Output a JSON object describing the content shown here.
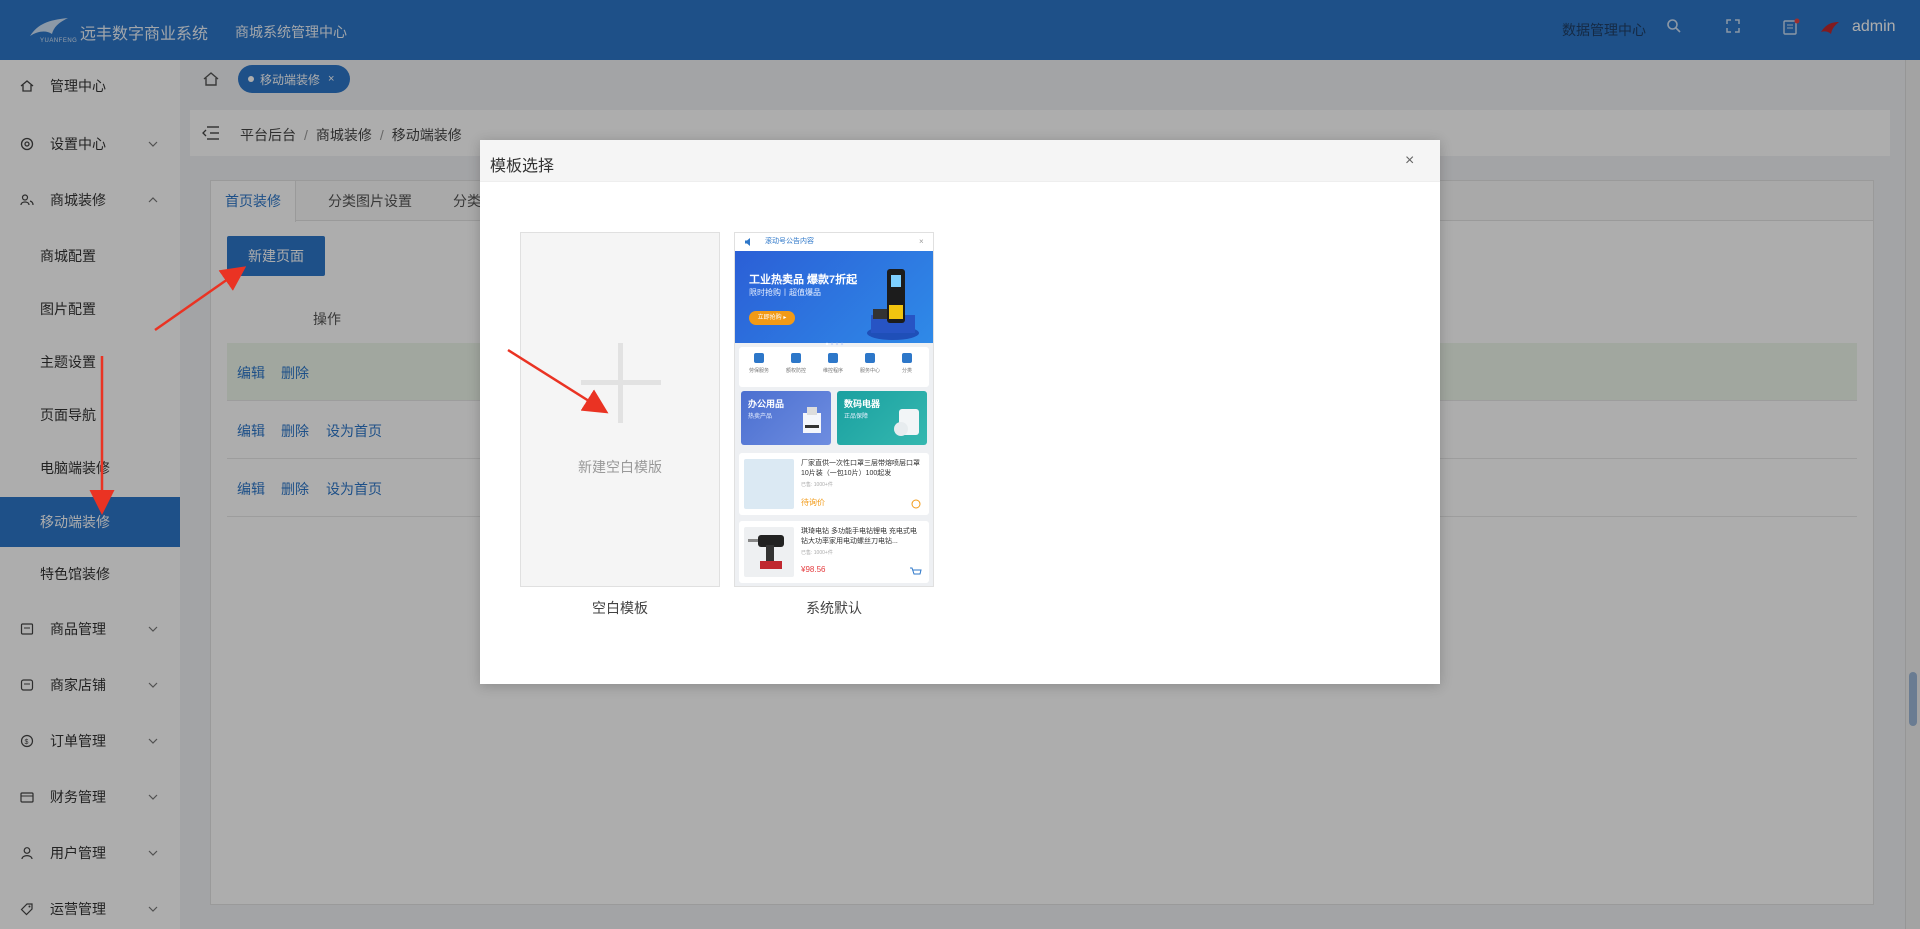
{
  "header": {
    "brand_sub": "YUANFENG",
    "app_name": "远丰数字商业系统",
    "app_subtitle": "商城系统管理中心",
    "data_center_link": "数据管理中心",
    "user": "admin"
  },
  "sidebar": {
    "items": [
      {
        "label": "管理中心",
        "icon": "home-icon"
      },
      {
        "label": "设置中心",
        "icon": "gear-icon"
      },
      {
        "label": "商城装修",
        "icon": "users-icon"
      },
      {
        "label": "商品管理",
        "icon": "box-icon"
      },
      {
        "label": "商家店铺",
        "icon": "store-icon"
      },
      {
        "label": "订单管理",
        "icon": "order-icon"
      },
      {
        "label": "财务管理",
        "icon": "wallet-icon"
      },
      {
        "label": "用户管理",
        "icon": "user-icon"
      },
      {
        "label": "运营管理",
        "icon": "tag-icon"
      }
    ],
    "subitems": [
      "商城配置",
      "图片配置",
      "主题设置",
      "页面导航",
      "电脑端装修",
      "移动端装修",
      "特色馆装修"
    ],
    "active_subitem": "移动端装修"
  },
  "tabstrip": {
    "open_tab": "移动端装修",
    "close": "×"
  },
  "breadcrumb": [
    "平台后台",
    "商城装修",
    "移动端装修"
  ],
  "content": {
    "tabs": [
      "首页装修",
      "分类图片设置",
      "分类"
    ],
    "new_button": "新建页面",
    "table_header": "操作",
    "rows": [
      {
        "edit": "编辑",
        "delete": "删除",
        "set_home": ""
      },
      {
        "edit": "编辑",
        "delete": "删除",
        "set_home": "设为首页"
      },
      {
        "edit": "编辑",
        "delete": "删除",
        "set_home": "设为首页"
      }
    ]
  },
  "modal": {
    "title": "模板选择",
    "close": "×",
    "blank_card_text": "新建空白模版",
    "blank_label": "空白模板",
    "default_label": "系统默认",
    "preview": {
      "notice": "滚动号公告内容",
      "banner_title": "工业热卖品 爆款7折起",
      "banner_sub": "限时抢购丨超值爆品",
      "banner_btn": "立即抢购 ▸",
      "icons": [
        "劳保服务",
        "额权防控",
        "维控程序",
        "服务中心",
        "分类"
      ],
      "cat1_title": "办公用品",
      "cat1_sub": "热卖产品",
      "cat2_title": "数码电器",
      "cat2_sub": "正品保障",
      "prod1_name": "厂家直供一次性口罩三层带熔喷层口罩10片装（一包10片）100起发",
      "prod1_sold": "已售: 1000+件",
      "prod1_price": "待询价",
      "prod2_name": "琪琦电钻 多功能手电钻锂电 充电式电钻大功率家用电动螺丝刀电钻...",
      "prod2_sold": "已售: 1000+件",
      "prod2_price": "¥98.56"
    }
  },
  "colors": {
    "primary": "#2d77c9",
    "header": "#2d77c9",
    "row_highlight": "#eef7ea"
  }
}
